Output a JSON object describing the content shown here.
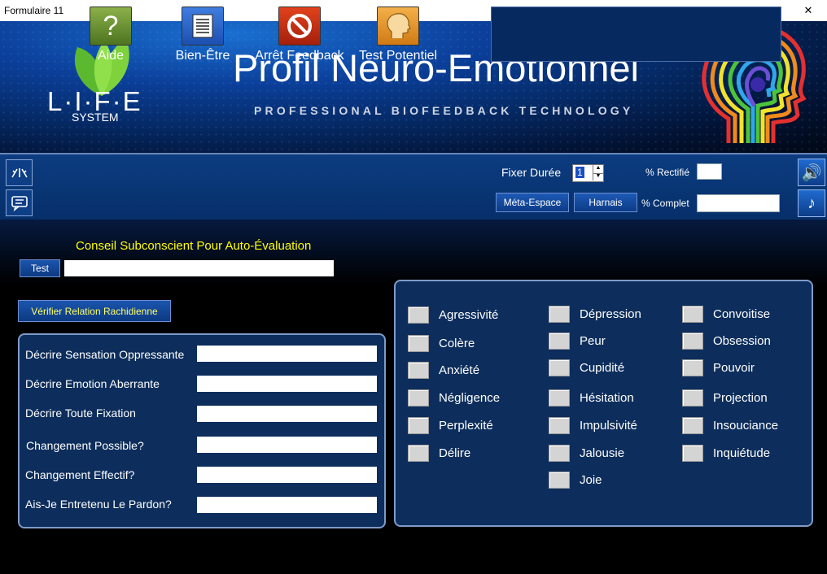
{
  "window": {
    "title": "Formulaire 11"
  },
  "header": {
    "title": "Profil Neuro-Emotionnel",
    "subtitle": "PROFESSIONAL BIOFEEDBACK TECHNOLOGY",
    "logo_text": "L·I·F·E",
    "logo_sub": "SYSTEM"
  },
  "toolbar": {
    "aide": "Aide",
    "bien_etre": "Bien-Être",
    "arret_feedback": "Arrêt Feedback",
    "test_potentiel": "Test Potentiel"
  },
  "controls": {
    "fixer_duree_label": "Fixer Durée",
    "fixer_duree_value": "1",
    "rectifie_label": "% Rectifié",
    "complet_label": "% Complet",
    "meta_espace": "Méta-Espace",
    "harnais": "Harnais"
  },
  "conseil": {
    "heading": "Conseil Subconscient Pour Auto-Évaluation",
    "test_button": "Test",
    "test_value": ""
  },
  "verifier_button": "Vérifier Relation Rachidienne",
  "questions": [
    {
      "label": "Décrire Sensation Oppressante",
      "value": ""
    },
    {
      "label": "Décrire Emotion Aberrante",
      "value": ""
    },
    {
      "label": "Décrire Toute Fixation",
      "value": ""
    },
    {
      "label": "Changement Possible?",
      "value": ""
    },
    {
      "label": "Changement Effectif?",
      "value": ""
    },
    {
      "label": "Ais-Je Entretenu Le Pardon?",
      "value": ""
    }
  ],
  "emotions": {
    "col1": [
      "Agressivité",
      "Colère",
      "Anxiété",
      "Négligence",
      "Perplexité",
      "Délire"
    ],
    "col2": [
      "Dépression",
      "Peur",
      "Cupidité",
      "Hésitation",
      "Impulsivité",
      "Jalousie",
      "Joie"
    ],
    "col3": [
      "Convoitise",
      "Obsession",
      "Pouvoir",
      "Projection",
      "Insouciance",
      "Inquiétude"
    ]
  },
  "colors": {
    "accent_yellow": "#ffff00",
    "panel_blue": "#0d2e5c",
    "toolbar_blue": "#0c3c80"
  }
}
